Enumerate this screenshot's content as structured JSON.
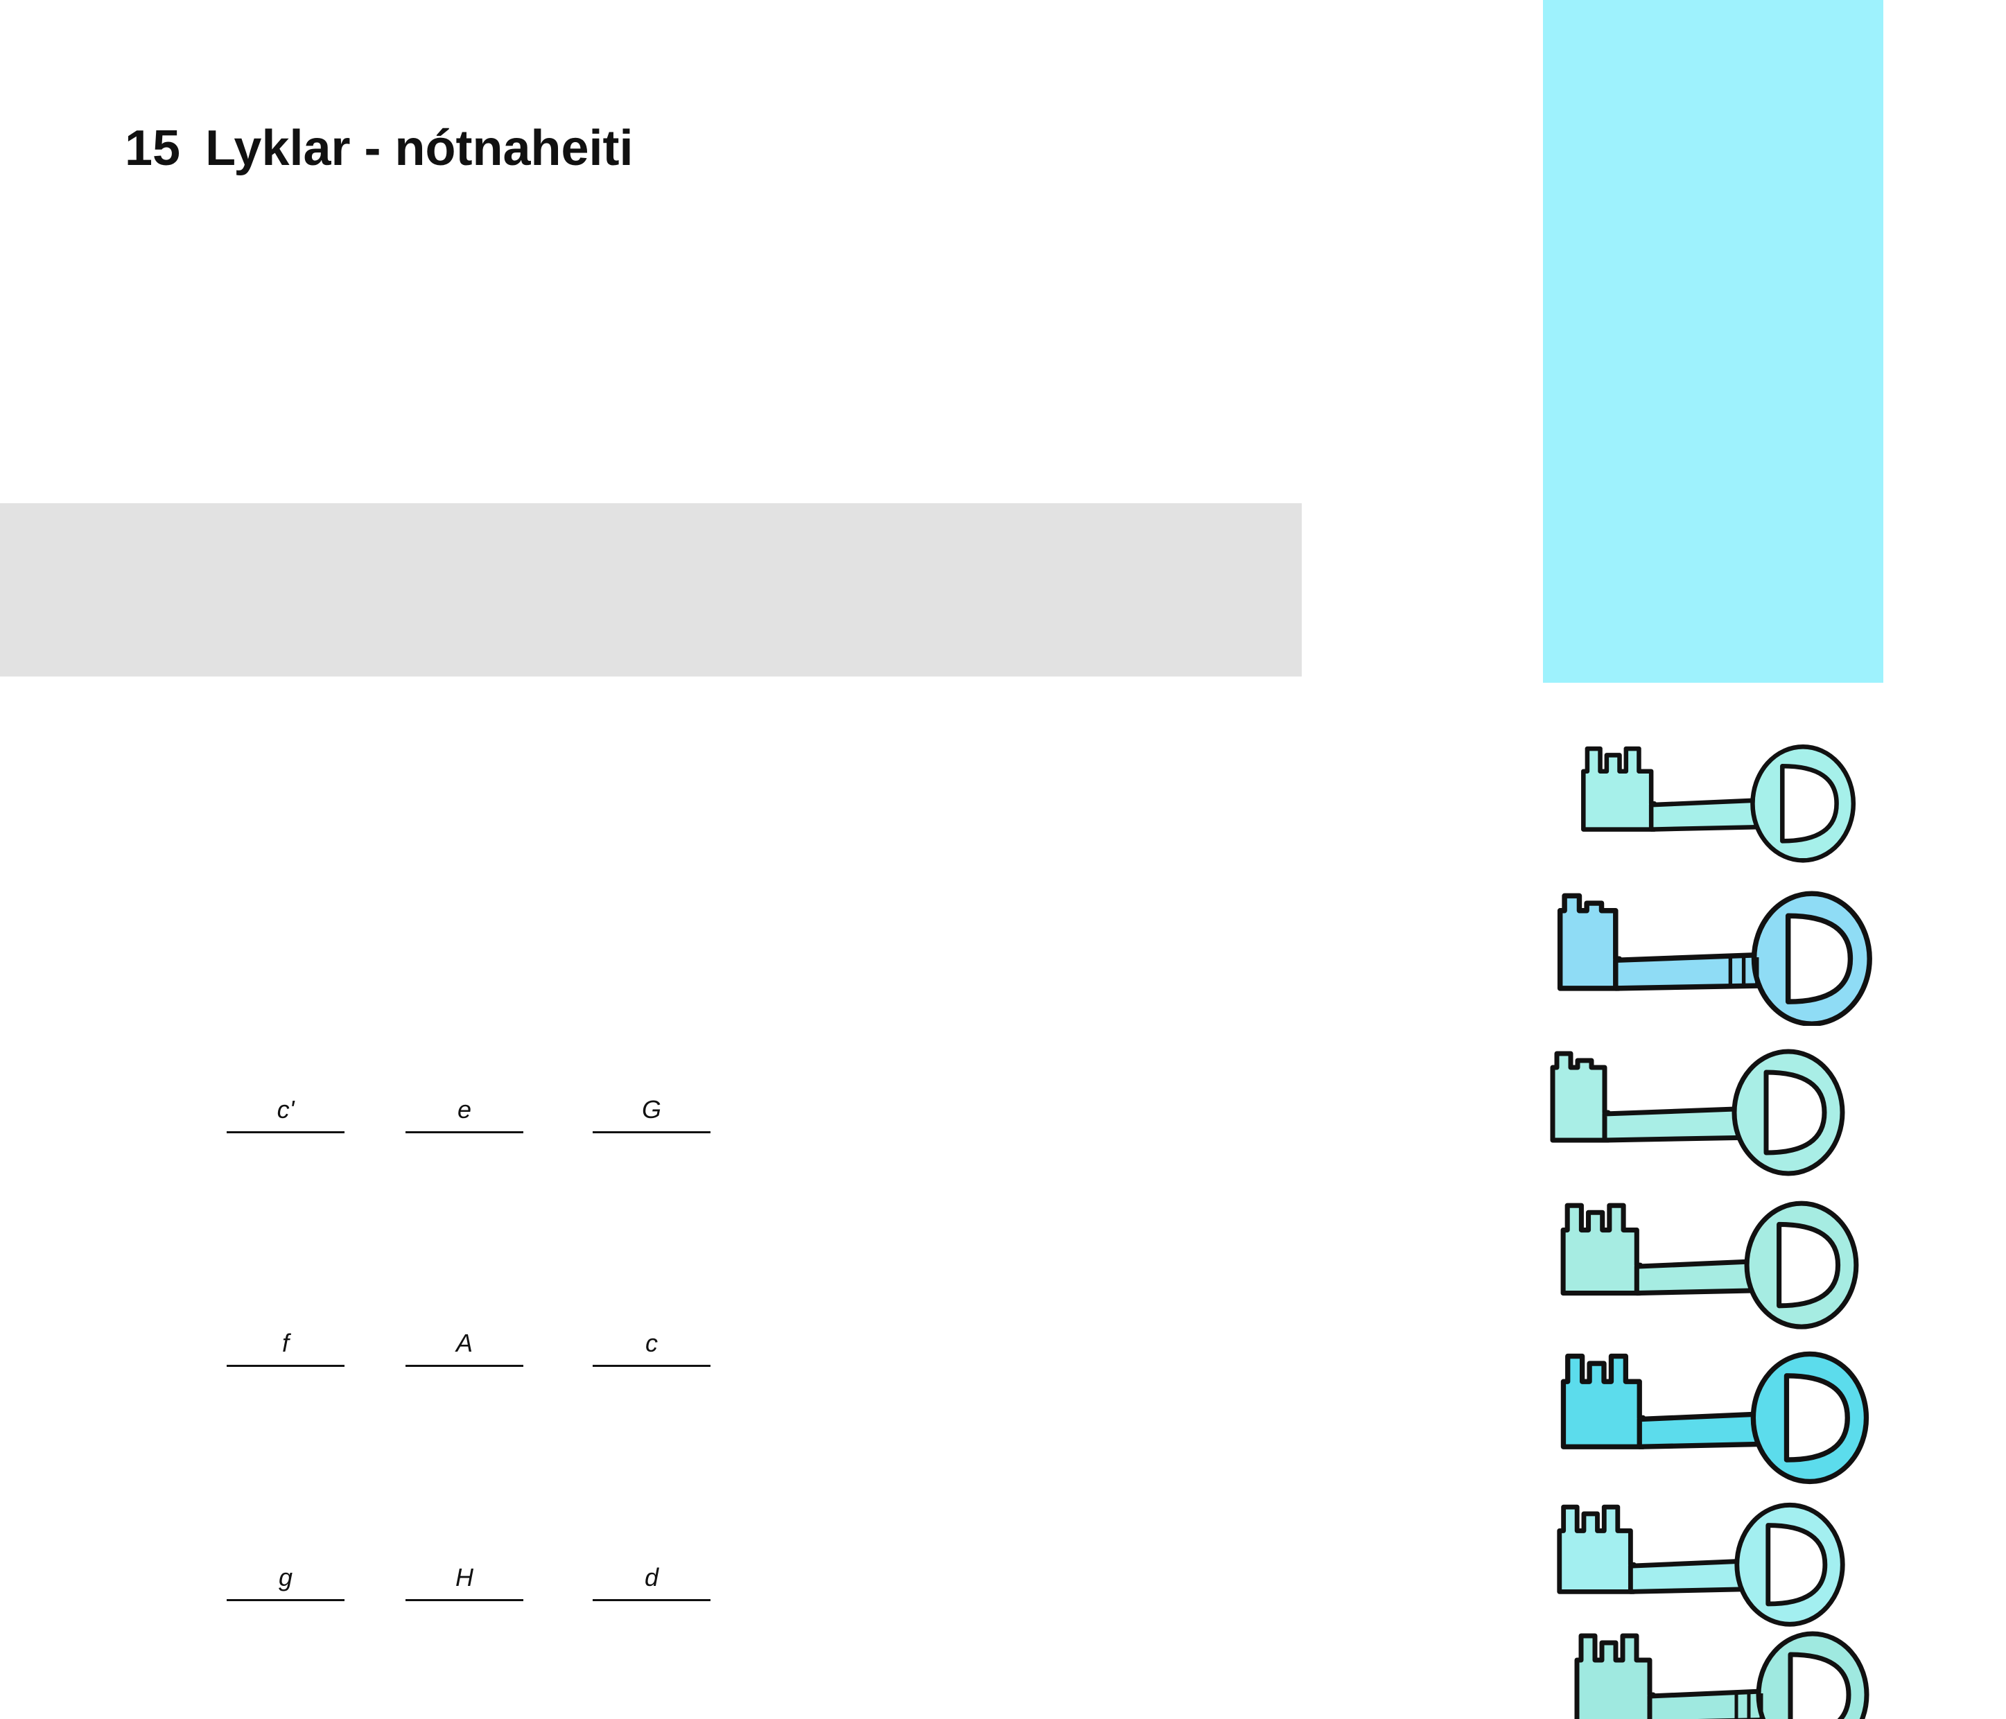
{
  "header": {
    "number": "15",
    "title": "Lyklar - nótnaheiti"
  },
  "colors": {
    "tab": "#9ef2fd",
    "band": "#e2e2e2",
    "keys": [
      "#a6f0ea",
      "#8fdcf5",
      "#a9eee6",
      "#a6ece2",
      "#5cdcec",
      "#a3eff0",
      "#9fe9e0"
    ]
  },
  "answers": {
    "rows": [
      [
        "c'",
        "e",
        "G"
      ],
      [
        "f",
        "A",
        "c"
      ],
      [
        "g",
        "H",
        "d"
      ]
    ]
  },
  "illustration": {
    "icon": "key-icon",
    "count": 7
  }
}
